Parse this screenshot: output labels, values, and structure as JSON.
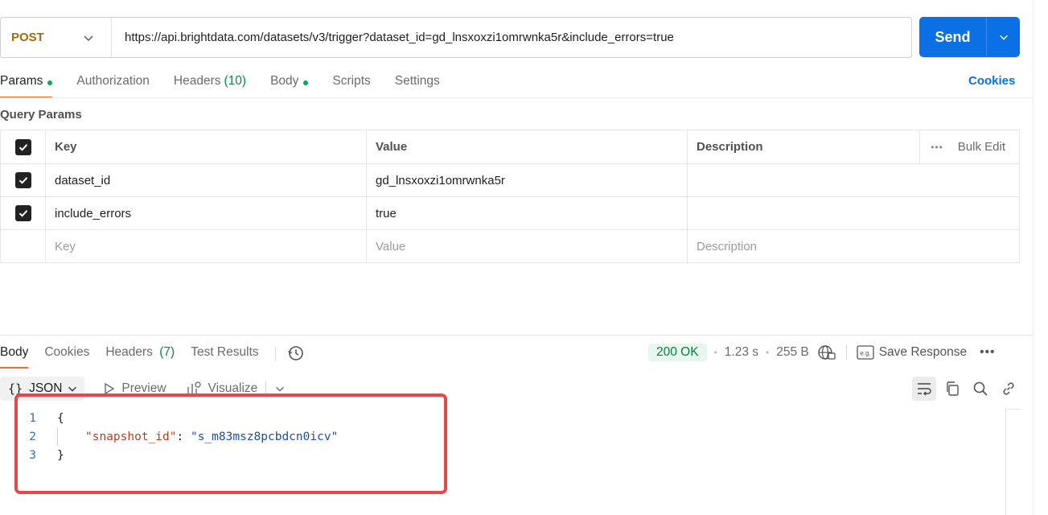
{
  "request": {
    "method": "POST",
    "url": "https://api.brightdata.com/datasets/v3/trigger?dataset_id=gd_lnsxoxzi1omrwnka5r&include_errors=true",
    "send_label": "Send"
  },
  "request_tabs": [
    {
      "label": "Params",
      "count": "",
      "dot": true,
      "active": true
    },
    {
      "label": "Authorization",
      "count": "",
      "dot": false,
      "active": false
    },
    {
      "label": "Headers",
      "count": "(10)",
      "dot": false,
      "active": false
    },
    {
      "label": "Body",
      "count": "",
      "dot": true,
      "active": false
    },
    {
      "label": "Scripts",
      "count": "",
      "dot": false,
      "active": false
    },
    {
      "label": "Settings",
      "count": "",
      "dot": false,
      "active": false
    }
  ],
  "cookies_link": "Cookies",
  "query_params": {
    "title": "Query Params",
    "columns": {
      "key": "Key",
      "value": "Value",
      "description": "Description",
      "bulk_edit": "Bulk Edit"
    },
    "rows": [
      {
        "key": "dataset_id",
        "value": "gd_lnsxoxzi1omrwnka5r",
        "description": "",
        "checked": true
      },
      {
        "key": "include_errors",
        "value": "true",
        "description": "",
        "checked": true
      }
    ],
    "placeholders": {
      "key": "Key",
      "value": "Value",
      "description": "Description"
    }
  },
  "response_tabs": [
    {
      "label": "Body",
      "count": "",
      "active": true
    },
    {
      "label": "Cookies",
      "count": "",
      "active": false
    },
    {
      "label": "Headers",
      "count": "(7)",
      "active": false
    },
    {
      "label": "Test Results",
      "count": "",
      "active": false
    }
  ],
  "response_meta": {
    "status": "200 OK",
    "time": "1.23 s",
    "size": "255 B",
    "save_label": "Save Response",
    "status_color": "#0a7f3f"
  },
  "format_bar": {
    "format": "JSON",
    "preview": "Preview",
    "visualize": "Visualize"
  },
  "code_lines": [
    {
      "n": "1",
      "text": "{"
    },
    {
      "n": "2",
      "key": "\"snapshot_id\"",
      "colon": ": ",
      "value": "\"s_m83msz8pcbdcn0icv\""
    },
    {
      "n": "3",
      "text": "}"
    }
  ],
  "colors": {
    "accent": "#0b6fe6",
    "tab_underline": "#f26b3a",
    "highlight": "#e5484d",
    "method": "#a56b10"
  }
}
